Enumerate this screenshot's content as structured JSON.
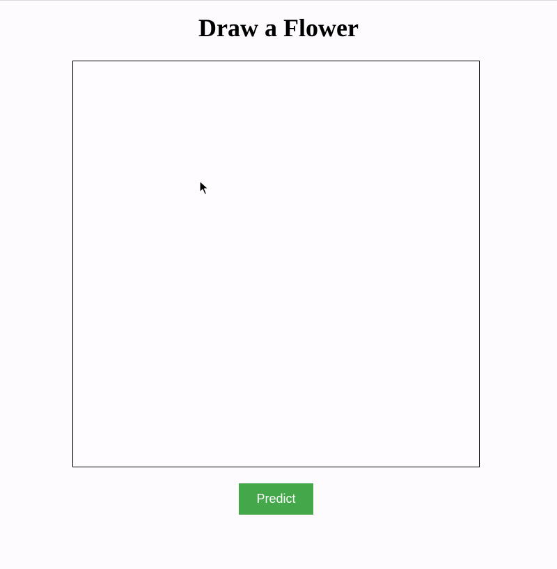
{
  "header": {
    "title": "Draw a Flower"
  },
  "canvas": {
    "icon": "arrow-cursor-icon"
  },
  "actions": {
    "predict_label": "Predict"
  },
  "colors": {
    "background": "#fdfbfe",
    "canvas_border": "#000000",
    "button": "#44a84a",
    "button_text": "#ffffff"
  }
}
